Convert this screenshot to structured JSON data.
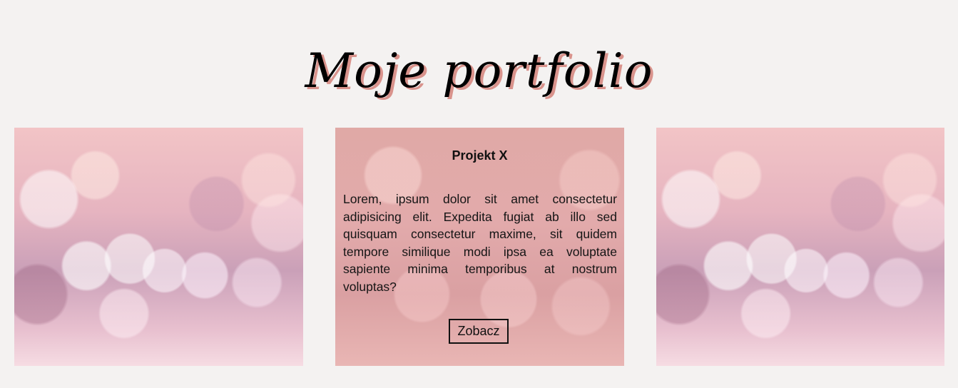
{
  "header": {
    "title": "Moje portfolio"
  },
  "projects": [
    {
      "image": "bokeh-photo"
    },
    {
      "image": "bokeh-photo",
      "title": "Projekt X",
      "description": "Lorem, ipsum dolor sit amet consectetur adipisicing elit. Expedita fugiat ab illo sed quisquam consectetur maxime, sit quidem tempore similique modi ipsa ea voluptate sapiente minima temporibus at nostrum voluptas?",
      "button_label": "Zobacz"
    },
    {
      "image": "bokeh-photo"
    }
  ],
  "colors": {
    "background": "#f4f2f1",
    "title_shadow": "#d9938c",
    "text": "#111111"
  }
}
